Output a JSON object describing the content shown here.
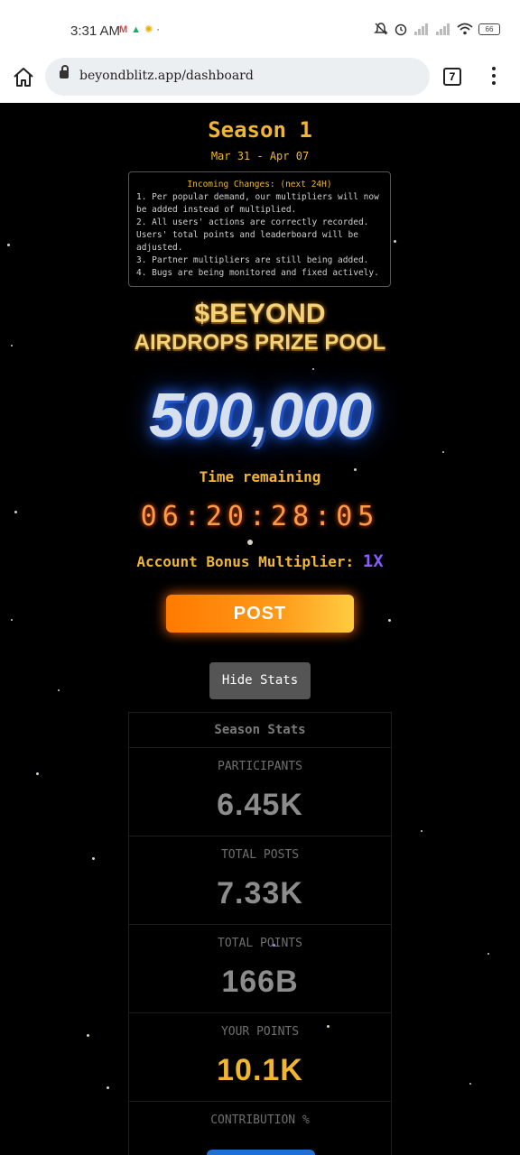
{
  "status_bar": {
    "time": "3:31 AM",
    "left_icons": [
      "gmail-icon",
      "drive-icon",
      "weather-icon",
      "dot-icon"
    ],
    "right_icons": [
      "mute-icon",
      "alarm-icon",
      "signal-icon",
      "signal-icon",
      "wifi-icon"
    ],
    "battery": "66"
  },
  "browser": {
    "url": "beyondblitz.app/dashboard",
    "tab_count": "7"
  },
  "season": {
    "title": "Season 1",
    "dates": "Mar 31 - Apr 07"
  },
  "changes": {
    "title": "Incoming Changes: (next 24H)",
    "lines": [
      "1. Per popular demand, our multipliers will now be added instead of multiplied.",
      "2. All users' actions are correctly recorded. Users' total points and leaderboard will be adjusted.",
      "3. Partner multipliers are still being added.",
      "4. Bugs are being monitored and fixed actively."
    ]
  },
  "prize": {
    "line1": "$BEYOND",
    "line2": "AIRDROPS PRIZE POOL",
    "amount": "500,000"
  },
  "timer": {
    "label": "Time remaining",
    "countdown": "06:20:28:05"
  },
  "multiplier": {
    "label": "Account Bonus Multiplier:",
    "value": "1X"
  },
  "buttons": {
    "post": "POST",
    "hide_stats": "Hide Stats"
  },
  "stats": {
    "header": "Season Stats",
    "items": [
      {
        "label": "PARTICIPANTS",
        "value": "6.45K"
      },
      {
        "label": "TOTAL POSTS",
        "value": "7.33K"
      },
      {
        "label": "TOTAL POINTS",
        "value": "166B"
      },
      {
        "label": "YOUR POINTS",
        "value": "10.1K"
      },
      {
        "label": "CONTRIBUTION %",
        "value": ""
      }
    ]
  },
  "colors": {
    "accent_gold": "#f0b632",
    "multiplier_purple": "#8a5cff",
    "post_orange": "#ff7a00",
    "countdown_orange": "#ff9a4a"
  }
}
